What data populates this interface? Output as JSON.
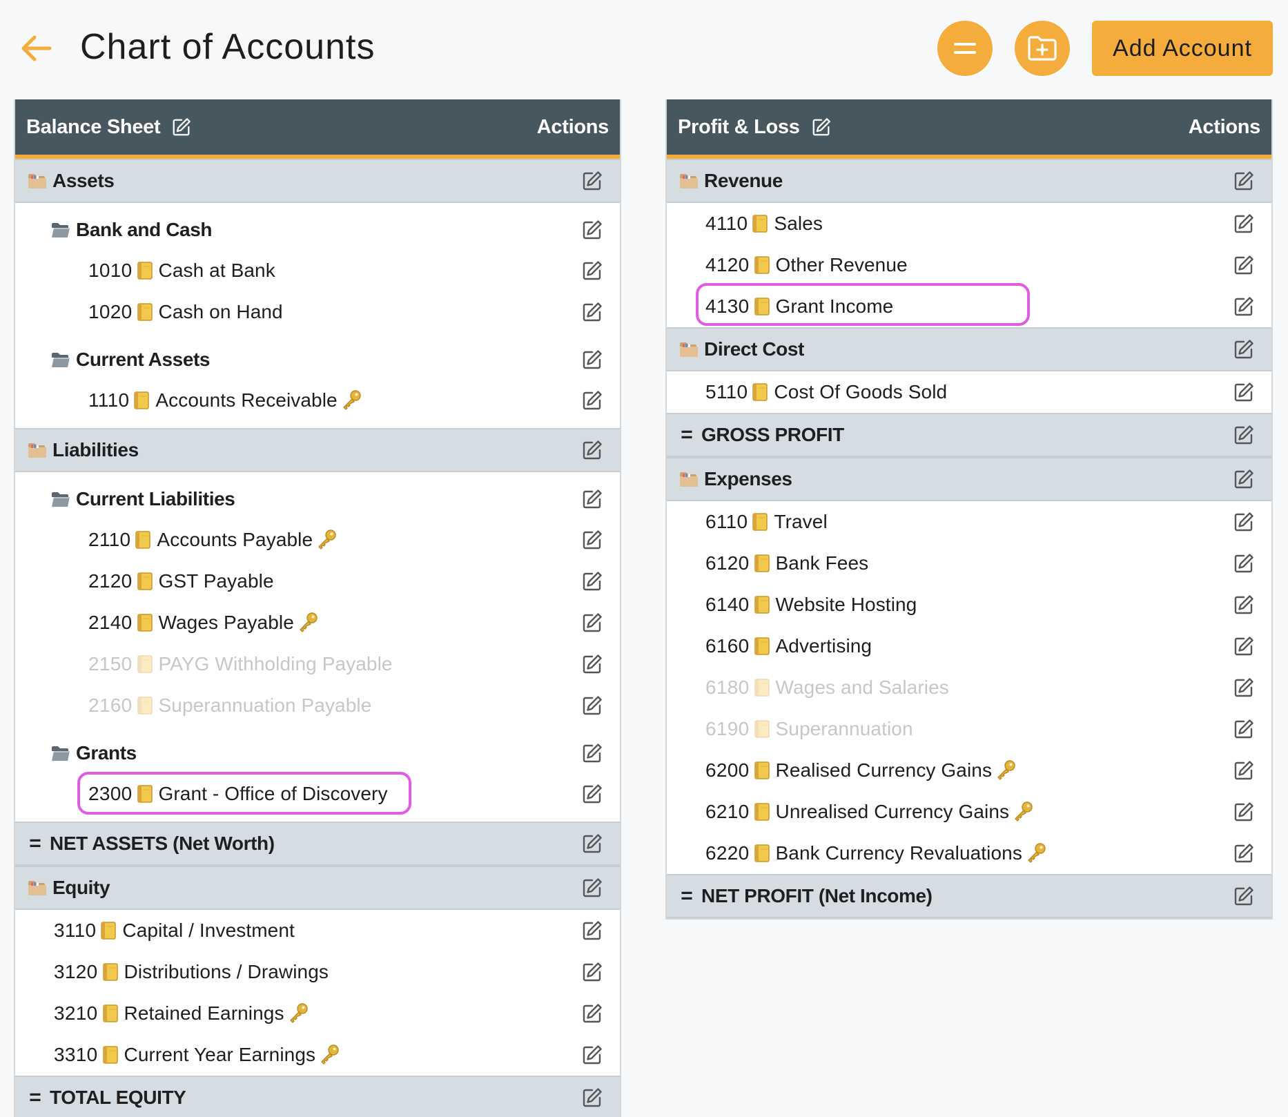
{
  "header": {
    "title": "Chart of Accounts",
    "add_account_label": "Add Account"
  },
  "colors": {
    "accent": "#f4ad3d",
    "panel_header": "#47575f",
    "section_bg": "#d6dde2",
    "highlight": "#e05ce0"
  },
  "balance_sheet": {
    "title": "Balance Sheet",
    "actions_label": "Actions",
    "assets": {
      "label": "Assets",
      "bank_and_cash": {
        "label": "Bank and Cash",
        "accounts": [
          {
            "code": "1010",
            "name": "Cash at Bank"
          },
          {
            "code": "1020",
            "name": "Cash on Hand"
          }
        ]
      },
      "current_assets": {
        "label": "Current Assets",
        "accounts": [
          {
            "code": "1110",
            "name": "Accounts Receivable",
            "locked": true
          }
        ]
      }
    },
    "liabilities": {
      "label": "Liabilities",
      "current_liabilities": {
        "label": "Current Liabilities",
        "accounts": [
          {
            "code": "2110",
            "name": "Accounts Payable",
            "locked": true
          },
          {
            "code": "2120",
            "name": "GST Payable"
          },
          {
            "code": "2140",
            "name": "Wages Payable",
            "locked": true
          },
          {
            "code": "2150",
            "name": "PAYG Withholding Payable",
            "inactive": true
          },
          {
            "code": "2160",
            "name": "Superannuation Payable",
            "inactive": true
          }
        ]
      },
      "grants": {
        "label": "Grants",
        "accounts": [
          {
            "code": "2300",
            "name": "Grant - Office of Discovery",
            "highlighted": true
          }
        ]
      }
    },
    "net_assets_label": "NET ASSETS (Net Worth)",
    "equity": {
      "label": "Equity",
      "accounts": [
        {
          "code": "3110",
          "name": "Capital / Investment"
        },
        {
          "code": "3120",
          "name": "Distributions / Drawings"
        },
        {
          "code": "3210",
          "name": "Retained Earnings",
          "locked": true
        },
        {
          "code": "3310",
          "name": "Current Year Earnings",
          "locked": true
        }
      ]
    },
    "total_equity_label": "TOTAL EQUITY"
  },
  "profit_loss": {
    "title": "Profit & Loss",
    "actions_label": "Actions",
    "revenue": {
      "label": "Revenue",
      "accounts": [
        {
          "code": "4110",
          "name": "Sales"
        },
        {
          "code": "4120",
          "name": "Other Revenue"
        },
        {
          "code": "4130",
          "name": "Grant Income",
          "highlighted": true
        }
      ]
    },
    "direct_cost": {
      "label": "Direct Cost",
      "accounts": [
        {
          "code": "5110",
          "name": "Cost Of Goods Sold"
        }
      ]
    },
    "gross_profit_label": "GROSS PROFIT",
    "expenses": {
      "label": "Expenses",
      "accounts": [
        {
          "code": "6110",
          "name": "Travel"
        },
        {
          "code": "6120",
          "name": "Bank Fees"
        },
        {
          "code": "6140",
          "name": "Website Hosting"
        },
        {
          "code": "6160",
          "name": "Advertising"
        },
        {
          "code": "6180",
          "name": "Wages and Salaries",
          "inactive": true
        },
        {
          "code": "6190",
          "name": "Superannuation",
          "inactive": true
        },
        {
          "code": "6200",
          "name": "Realised Currency Gains",
          "locked": true
        },
        {
          "code": "6210",
          "name": "Unrealised Currency Gains",
          "locked": true
        },
        {
          "code": "6220",
          "name": "Bank Currency Revaluations",
          "locked": true
        }
      ]
    },
    "net_profit_label": "NET PROFIT (Net Income)"
  }
}
